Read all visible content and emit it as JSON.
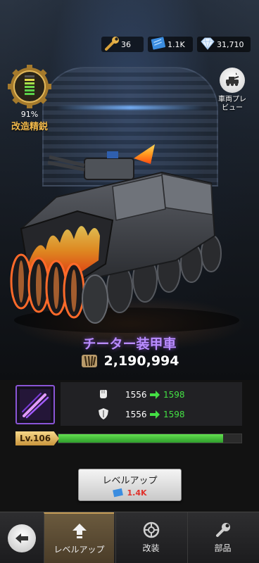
{
  "resources": [
    {
      "icon": "wrench-icon",
      "value": "36"
    },
    {
      "icon": "blueprint-icon",
      "value": "1.1K"
    },
    {
      "icon": "diamond-icon",
      "value": "31,710"
    }
  ],
  "mod_badge": {
    "percent": "91%",
    "label": "改造精鋭"
  },
  "preview": {
    "label_line1": "車両プレ",
    "label_line2": "ビュー"
  },
  "vehicle": {
    "name": "チーター装甲車",
    "power": "2,190,994"
  },
  "stats": [
    {
      "icon": "attack-fist-icon",
      "current": "1556",
      "next": "1598"
    },
    {
      "icon": "defense-shield-icon",
      "current": "1556",
      "next": "1598"
    }
  ],
  "level": {
    "label": "Lv.106",
    "progress": 0.9
  },
  "level_up": {
    "label": "レベルアップ",
    "cost": "1.4K"
  },
  "nav": {
    "tabs": [
      {
        "label": "レベルアップ",
        "icon": "level-up-arrow-icon",
        "active": true
      },
      {
        "label": "改装",
        "icon": "modify-gear-icon",
        "active": false
      },
      {
        "label": "部品",
        "icon": "parts-wrench-icon",
        "active": false
      }
    ]
  },
  "colors": {
    "accent_gold": "#f0b84a",
    "name_purple": "#b98cff",
    "stat_green": "#44e044",
    "bar_green": "#4cc83f",
    "cost_red": "#e0322c"
  }
}
